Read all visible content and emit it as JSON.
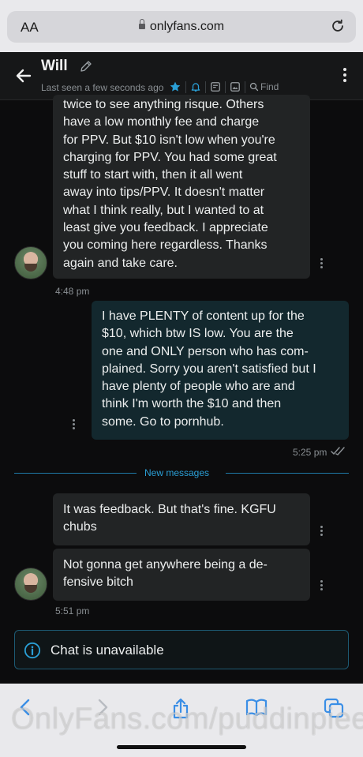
{
  "browser": {
    "text_size_label": "AA",
    "url": "onlyfans.com"
  },
  "header": {
    "name": "Will",
    "last_seen": "Last seen a few seconds ago",
    "find_label": "Find",
    "icons": [
      "star-icon",
      "bell-icon",
      "notes-icon",
      "media-icon",
      "search-icon"
    ]
  },
  "messages": [
    {
      "direction": "incoming",
      "lines": [
        "twice to see anything risque. Others",
        "have a low monthly fee and charge",
        "for PPV. But $10 isn't low when you're",
        "charging for PPV. You had some great",
        "stuff to start with, then it all went",
        "away into tips/PPV. It doesn't matter",
        "what I think really, but I wanted to at",
        "least give you feedback. I appreciate",
        "you coming here regardless. Thanks",
        "again and take care."
      ],
      "time": "4:48 pm"
    },
    {
      "direction": "outgoing",
      "lines": [
        "I have PLENTY of content up for the",
        "$10, which btw IS low. You are the",
        "one and ONLY person who has com-",
        "plained. Sorry you aren't satisfied but I",
        "have plenty of people who are and",
        "think I'm worth the $10 and then",
        "some. Go to pornhub."
      ],
      "time": "5:25 pm"
    },
    {
      "direction": "incoming",
      "lines": [
        "It was feedback. But that's fine. KGFU",
        "chubs"
      ]
    },
    {
      "direction": "incoming",
      "lines": [
        "Not gonna get anywhere being a de-",
        "fensive bitch"
      ],
      "time": "5:51 pm"
    }
  ],
  "divider_label": "New messages",
  "notice": "Chat is unavailable",
  "watermark": "OnlyFans.com/puddinpiee"
}
